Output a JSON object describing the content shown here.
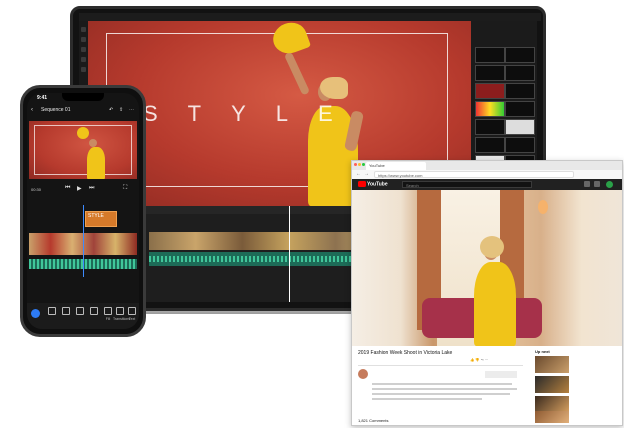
{
  "laptop": {
    "app_title": "",
    "monitor_overlay_text": "STYLE"
  },
  "phone": {
    "time": "9:41",
    "sequence_title": "Sequence 01",
    "timecode": "00:30",
    "title_clip_label": "STYLE",
    "bottom_bar": [
      "",
      "",
      "",
      "",
      "Fill",
      "Transitions",
      "Text"
    ]
  },
  "browser": {
    "tab_label": "YouTube",
    "url": "https://www.youtube.com",
    "yt_logo": "YouTube",
    "search_placeholder": "Search",
    "video_title": "2019 Fashion Week Shoot in Victoria Lake",
    "views": "",
    "channel_name": "",
    "channel_date": "",
    "subscribe_label": "",
    "show_more": "",
    "comments": "1,821 Comments",
    "up_next": "Up next",
    "autoplay": "",
    "recommendations": [
      {
        "title": "",
        "meta": ""
      },
      {
        "title": "",
        "meta": ""
      },
      {
        "title": "",
        "meta": ""
      },
      {
        "title": "",
        "meta": ""
      }
    ]
  },
  "colors": {
    "red_wall": "#b93a2e",
    "yellow_dress": "#f0c419",
    "editor_dark": "#121212",
    "youtube_red": "#ff0000",
    "audio_green": "#40c79a"
  }
}
